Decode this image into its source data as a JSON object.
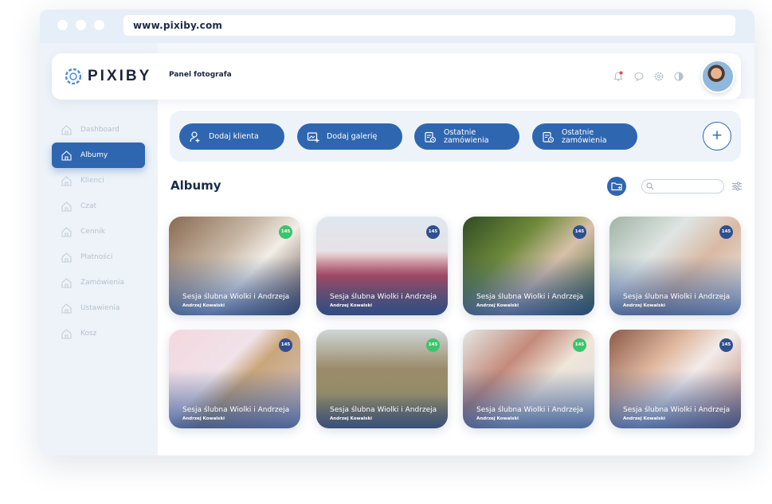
{
  "browser": {
    "url": "www.pixiby.com"
  },
  "header": {
    "logo_text": "PIXIBY",
    "panel_label": "Panel fotografa"
  },
  "sidebar": {
    "items": [
      {
        "label": "Dashboard",
        "active": false
      },
      {
        "label": "Albumy",
        "active": true
      },
      {
        "label": "Klienci",
        "active": false
      },
      {
        "label": "Czat",
        "active": false
      },
      {
        "label": "Cennik",
        "active": false
      },
      {
        "label": "Płatności",
        "active": false
      },
      {
        "label": "Zamówienia",
        "active": false
      },
      {
        "label": "Ustawienia",
        "active": false
      },
      {
        "label": "Kosz",
        "active": false
      }
    ]
  },
  "actions": {
    "add_client": "Dodaj klienta",
    "add_gallery": "Dodaj galerię",
    "recent_orders_1": {
      "line1": "Ostatnie",
      "line2": "zamówienia"
    },
    "recent_orders_2": {
      "line1": "Ostatnie",
      "line2": "zamówienia"
    },
    "plus": "+"
  },
  "main": {
    "section_title": "Albumy",
    "albums": [
      {
        "title": "Sesja ślubna Wiolki i Andrzeja",
        "subtitle": "Andrzej Kowalski",
        "count": "145",
        "badge_color": "#3cc46b"
      },
      {
        "title": "Sesja ślubna Wiolki i Andrzeja",
        "subtitle": "Andrzej Kowalski",
        "count": "145",
        "badge_color": "#2f4f8f"
      },
      {
        "title": "Sesja ślubna Wiolki i Andrzeja",
        "subtitle": "Andrzej Kowalski",
        "count": "145",
        "badge_color": "#2f4f8f"
      },
      {
        "title": "Sesja ślubna Wiolki i Andrzeja",
        "subtitle": "Andrzej Kowalski",
        "count": "145",
        "badge_color": "#2f4f8f"
      },
      {
        "title": "Sesja ślubna Wiolki i Andrzeja",
        "subtitle": "Andrzej Kowalski",
        "count": "145",
        "badge_color": "#2f4f8f"
      },
      {
        "title": "Sesja ślubna Wiolki i Andrzeja",
        "subtitle": "Andrzej Kowalski",
        "count": "145",
        "badge_color": "#3cc46b"
      },
      {
        "title": "Sesja ślubna Wiolki i Andrzeja",
        "subtitle": "Andrzej Kowalski",
        "count": "145",
        "badge_color": "#3cc46b"
      },
      {
        "title": "Sesja ślubna Wiolki i Andrzeja",
        "subtitle": "Andrzej Kowalski",
        "count": "145",
        "badge_color": "#2f4f8f"
      }
    ]
  },
  "colors": {
    "accent": "#2f66b0",
    "sidebar_bg": "#eef3f9",
    "badge_green": "#3cc46b",
    "badge_navy": "#2f4f8f"
  }
}
